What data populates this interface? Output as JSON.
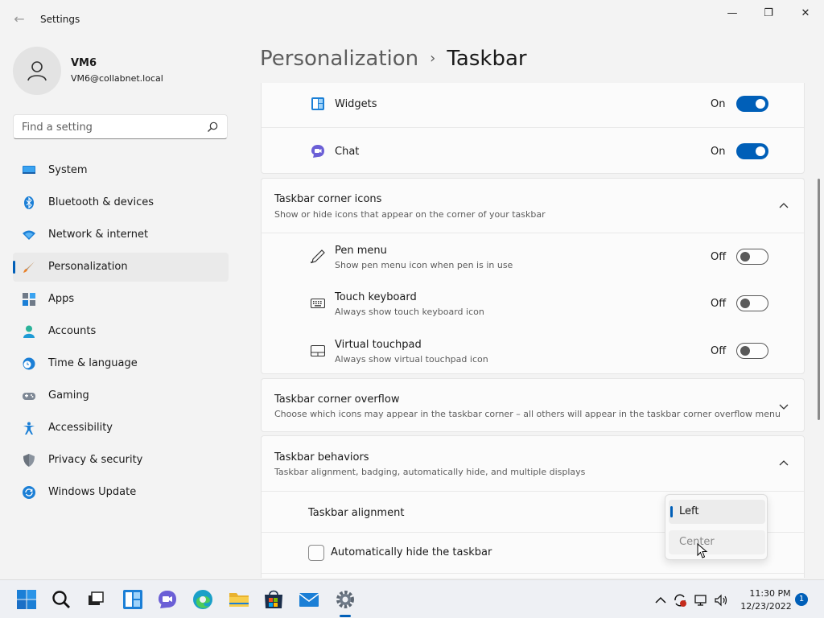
{
  "window": {
    "app_title": "Settings",
    "back_glyph": "←",
    "minimize_glyph": "—",
    "maximize_glyph": "❐",
    "close_glyph": "✕"
  },
  "profile": {
    "name": "VM6",
    "email": "VM6@collabnet.local"
  },
  "search": {
    "placeholder": "Find a setting"
  },
  "nav": {
    "items": [
      {
        "label": "System",
        "icon": "monitor-icon"
      },
      {
        "label": "Bluetooth & devices",
        "icon": "bluetooth-icon"
      },
      {
        "label": "Network & internet",
        "icon": "wifi-icon"
      },
      {
        "label": "Personalization",
        "icon": "paintbrush-icon"
      },
      {
        "label": "Apps",
        "icon": "apps-icon"
      },
      {
        "label": "Accounts",
        "icon": "person-icon"
      },
      {
        "label": "Time & language",
        "icon": "clock-globe-icon"
      },
      {
        "label": "Gaming",
        "icon": "gamepad-icon"
      },
      {
        "label": "Accessibility",
        "icon": "accessibility-icon"
      },
      {
        "label": "Privacy & security",
        "icon": "shield-icon"
      },
      {
        "label": "Windows Update",
        "icon": "update-icon"
      }
    ],
    "active_index": 3
  },
  "breadcrumb": {
    "parent": "Personalization",
    "separator": "›",
    "current": "Taskbar"
  },
  "taskbar_items": {
    "widgets": {
      "label": "Widgets",
      "state": "On",
      "on": true
    },
    "chat": {
      "label": "Chat",
      "state": "On",
      "on": true
    }
  },
  "corner_icons": {
    "title": "Taskbar corner icons",
    "subtitle": "Show or hide icons that appear on the corner of your taskbar",
    "expanded": true,
    "items": [
      {
        "label": "Pen menu",
        "sub": "Show pen menu icon when pen is in use",
        "state": "Off",
        "icon": "pen-icon"
      },
      {
        "label": "Touch keyboard",
        "sub": "Always show touch keyboard icon",
        "state": "Off",
        "icon": "keyboard-icon"
      },
      {
        "label": "Virtual touchpad",
        "sub": "Always show virtual touchpad icon",
        "state": "Off",
        "icon": "touchpad-icon"
      }
    ]
  },
  "corner_overflow": {
    "title": "Taskbar corner overflow",
    "subtitle": "Choose which icons may appear in the taskbar corner – all others will appear in the taskbar corner overflow menu",
    "expanded": false
  },
  "behaviors": {
    "title": "Taskbar behaviors",
    "subtitle": "Taskbar alignment, badging, automatically hide, and multiple displays",
    "expanded": true,
    "alignment_label": "Taskbar alignment",
    "alignment_options": [
      "Left",
      "Center"
    ],
    "alignment_selected": "Left",
    "autohide_label": "Automatically hide the taskbar",
    "autohide_checked": false
  },
  "system_tray": {
    "time": "11:30 PM",
    "date": "12/23/2022",
    "notification_count": "1"
  },
  "colors": {
    "accent": "#005fb8",
    "background": "#f3f3f3",
    "card": "#fbfbfb"
  }
}
